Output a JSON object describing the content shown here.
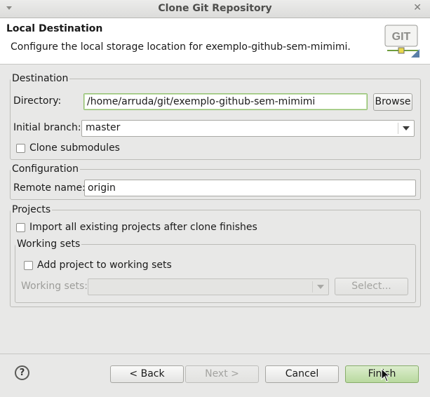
{
  "window": {
    "title": "Clone Git Repository"
  },
  "header": {
    "title": "Local Destination",
    "description": "Configure the local storage location for exemplo-github-sem-mimimi.",
    "logo_text": "GIT"
  },
  "destination": {
    "group_label": "Destination",
    "directory_label": "Directory:",
    "directory_value": "/home/arruda/git/exemplo-github-sem-mimimi",
    "browse_label": "Browse",
    "branch_label": "Initial branch:",
    "branch_value": "master",
    "clone_submodules_label": "Clone submodules",
    "clone_submodules_checked": false
  },
  "configuration": {
    "group_label": "Configuration",
    "remote_label": "Remote name:",
    "remote_value": "origin"
  },
  "projects": {
    "group_label": "Projects",
    "import_label": "Import all existing projects after clone finishes",
    "import_checked": false,
    "working_sets": {
      "group_label": "Working sets",
      "add_label": "Add project to working sets",
      "add_checked": false,
      "sets_label": "Working sets:",
      "sets_value": "",
      "select_label": "Select..."
    }
  },
  "footer": {
    "help_icon": "?",
    "back_label": "< Back",
    "next_label": "Next >",
    "cancel_label": "Cancel",
    "finish_label": "Finish"
  }
}
